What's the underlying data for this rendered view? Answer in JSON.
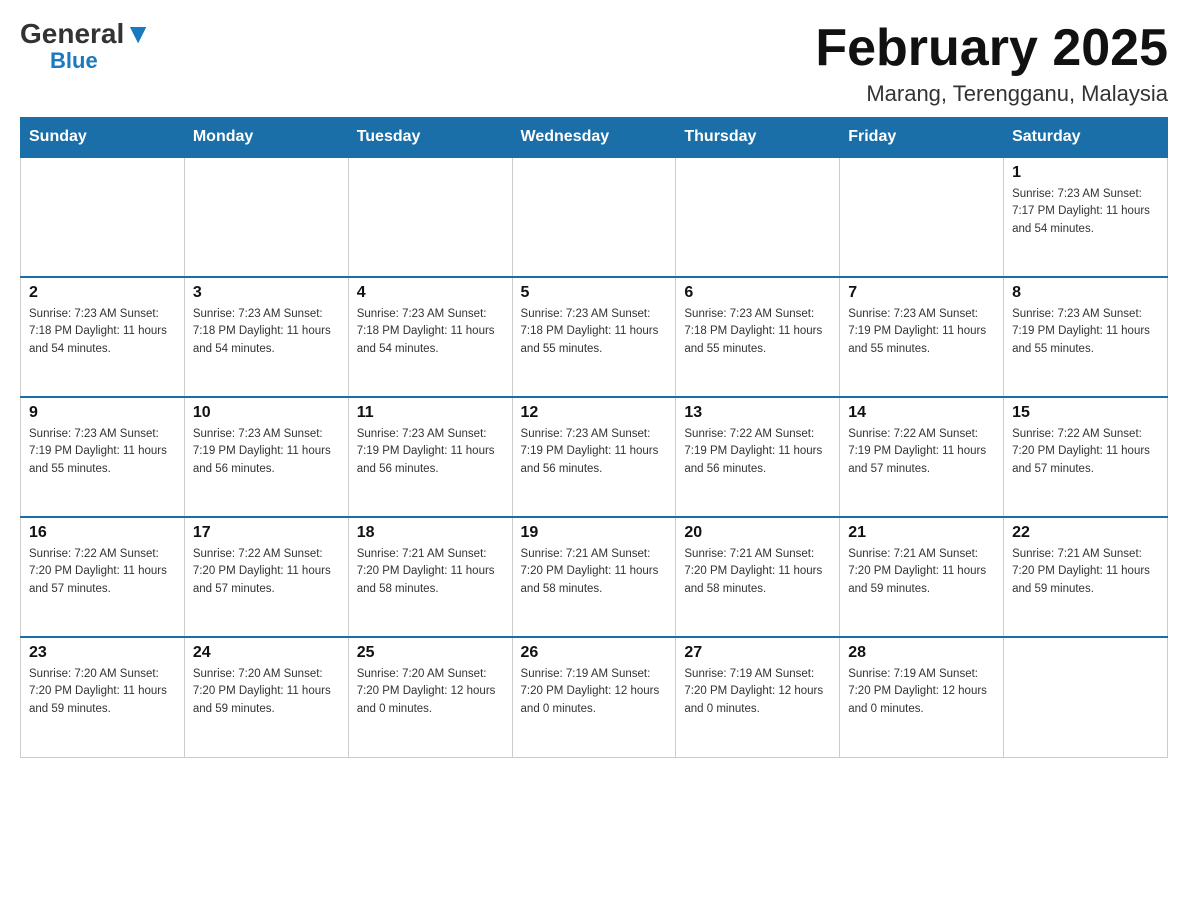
{
  "header": {
    "logo_general": "General",
    "logo_blue": "Blue",
    "month_title": "February 2025",
    "location": "Marang, Terengganu, Malaysia"
  },
  "days_of_week": [
    "Sunday",
    "Monday",
    "Tuesday",
    "Wednesday",
    "Thursday",
    "Friday",
    "Saturday"
  ],
  "weeks": [
    {
      "days": [
        {
          "number": "",
          "info": ""
        },
        {
          "number": "",
          "info": ""
        },
        {
          "number": "",
          "info": ""
        },
        {
          "number": "",
          "info": ""
        },
        {
          "number": "",
          "info": ""
        },
        {
          "number": "",
          "info": ""
        },
        {
          "number": "1",
          "info": "Sunrise: 7:23 AM\nSunset: 7:17 PM\nDaylight: 11 hours\nand 54 minutes."
        }
      ]
    },
    {
      "days": [
        {
          "number": "2",
          "info": "Sunrise: 7:23 AM\nSunset: 7:18 PM\nDaylight: 11 hours\nand 54 minutes."
        },
        {
          "number": "3",
          "info": "Sunrise: 7:23 AM\nSunset: 7:18 PM\nDaylight: 11 hours\nand 54 minutes."
        },
        {
          "number": "4",
          "info": "Sunrise: 7:23 AM\nSunset: 7:18 PM\nDaylight: 11 hours\nand 54 minutes."
        },
        {
          "number": "5",
          "info": "Sunrise: 7:23 AM\nSunset: 7:18 PM\nDaylight: 11 hours\nand 55 minutes."
        },
        {
          "number": "6",
          "info": "Sunrise: 7:23 AM\nSunset: 7:18 PM\nDaylight: 11 hours\nand 55 minutes."
        },
        {
          "number": "7",
          "info": "Sunrise: 7:23 AM\nSunset: 7:19 PM\nDaylight: 11 hours\nand 55 minutes."
        },
        {
          "number": "8",
          "info": "Sunrise: 7:23 AM\nSunset: 7:19 PM\nDaylight: 11 hours\nand 55 minutes."
        }
      ]
    },
    {
      "days": [
        {
          "number": "9",
          "info": "Sunrise: 7:23 AM\nSunset: 7:19 PM\nDaylight: 11 hours\nand 55 minutes."
        },
        {
          "number": "10",
          "info": "Sunrise: 7:23 AM\nSunset: 7:19 PM\nDaylight: 11 hours\nand 56 minutes."
        },
        {
          "number": "11",
          "info": "Sunrise: 7:23 AM\nSunset: 7:19 PM\nDaylight: 11 hours\nand 56 minutes."
        },
        {
          "number": "12",
          "info": "Sunrise: 7:23 AM\nSunset: 7:19 PM\nDaylight: 11 hours\nand 56 minutes."
        },
        {
          "number": "13",
          "info": "Sunrise: 7:22 AM\nSunset: 7:19 PM\nDaylight: 11 hours\nand 56 minutes."
        },
        {
          "number": "14",
          "info": "Sunrise: 7:22 AM\nSunset: 7:19 PM\nDaylight: 11 hours\nand 57 minutes."
        },
        {
          "number": "15",
          "info": "Sunrise: 7:22 AM\nSunset: 7:20 PM\nDaylight: 11 hours\nand 57 minutes."
        }
      ]
    },
    {
      "days": [
        {
          "number": "16",
          "info": "Sunrise: 7:22 AM\nSunset: 7:20 PM\nDaylight: 11 hours\nand 57 minutes."
        },
        {
          "number": "17",
          "info": "Sunrise: 7:22 AM\nSunset: 7:20 PM\nDaylight: 11 hours\nand 57 minutes."
        },
        {
          "number": "18",
          "info": "Sunrise: 7:21 AM\nSunset: 7:20 PM\nDaylight: 11 hours\nand 58 minutes."
        },
        {
          "number": "19",
          "info": "Sunrise: 7:21 AM\nSunset: 7:20 PM\nDaylight: 11 hours\nand 58 minutes."
        },
        {
          "number": "20",
          "info": "Sunrise: 7:21 AM\nSunset: 7:20 PM\nDaylight: 11 hours\nand 58 minutes."
        },
        {
          "number": "21",
          "info": "Sunrise: 7:21 AM\nSunset: 7:20 PM\nDaylight: 11 hours\nand 59 minutes."
        },
        {
          "number": "22",
          "info": "Sunrise: 7:21 AM\nSunset: 7:20 PM\nDaylight: 11 hours\nand 59 minutes."
        }
      ]
    },
    {
      "days": [
        {
          "number": "23",
          "info": "Sunrise: 7:20 AM\nSunset: 7:20 PM\nDaylight: 11 hours\nand 59 minutes."
        },
        {
          "number": "24",
          "info": "Sunrise: 7:20 AM\nSunset: 7:20 PM\nDaylight: 11 hours\nand 59 minutes."
        },
        {
          "number": "25",
          "info": "Sunrise: 7:20 AM\nSunset: 7:20 PM\nDaylight: 12 hours\nand 0 minutes."
        },
        {
          "number": "26",
          "info": "Sunrise: 7:19 AM\nSunset: 7:20 PM\nDaylight: 12 hours\nand 0 minutes."
        },
        {
          "number": "27",
          "info": "Sunrise: 7:19 AM\nSunset: 7:20 PM\nDaylight: 12 hours\nand 0 minutes."
        },
        {
          "number": "28",
          "info": "Sunrise: 7:19 AM\nSunset: 7:20 PM\nDaylight: 12 hours\nand 0 minutes."
        },
        {
          "number": "",
          "info": ""
        }
      ]
    }
  ]
}
